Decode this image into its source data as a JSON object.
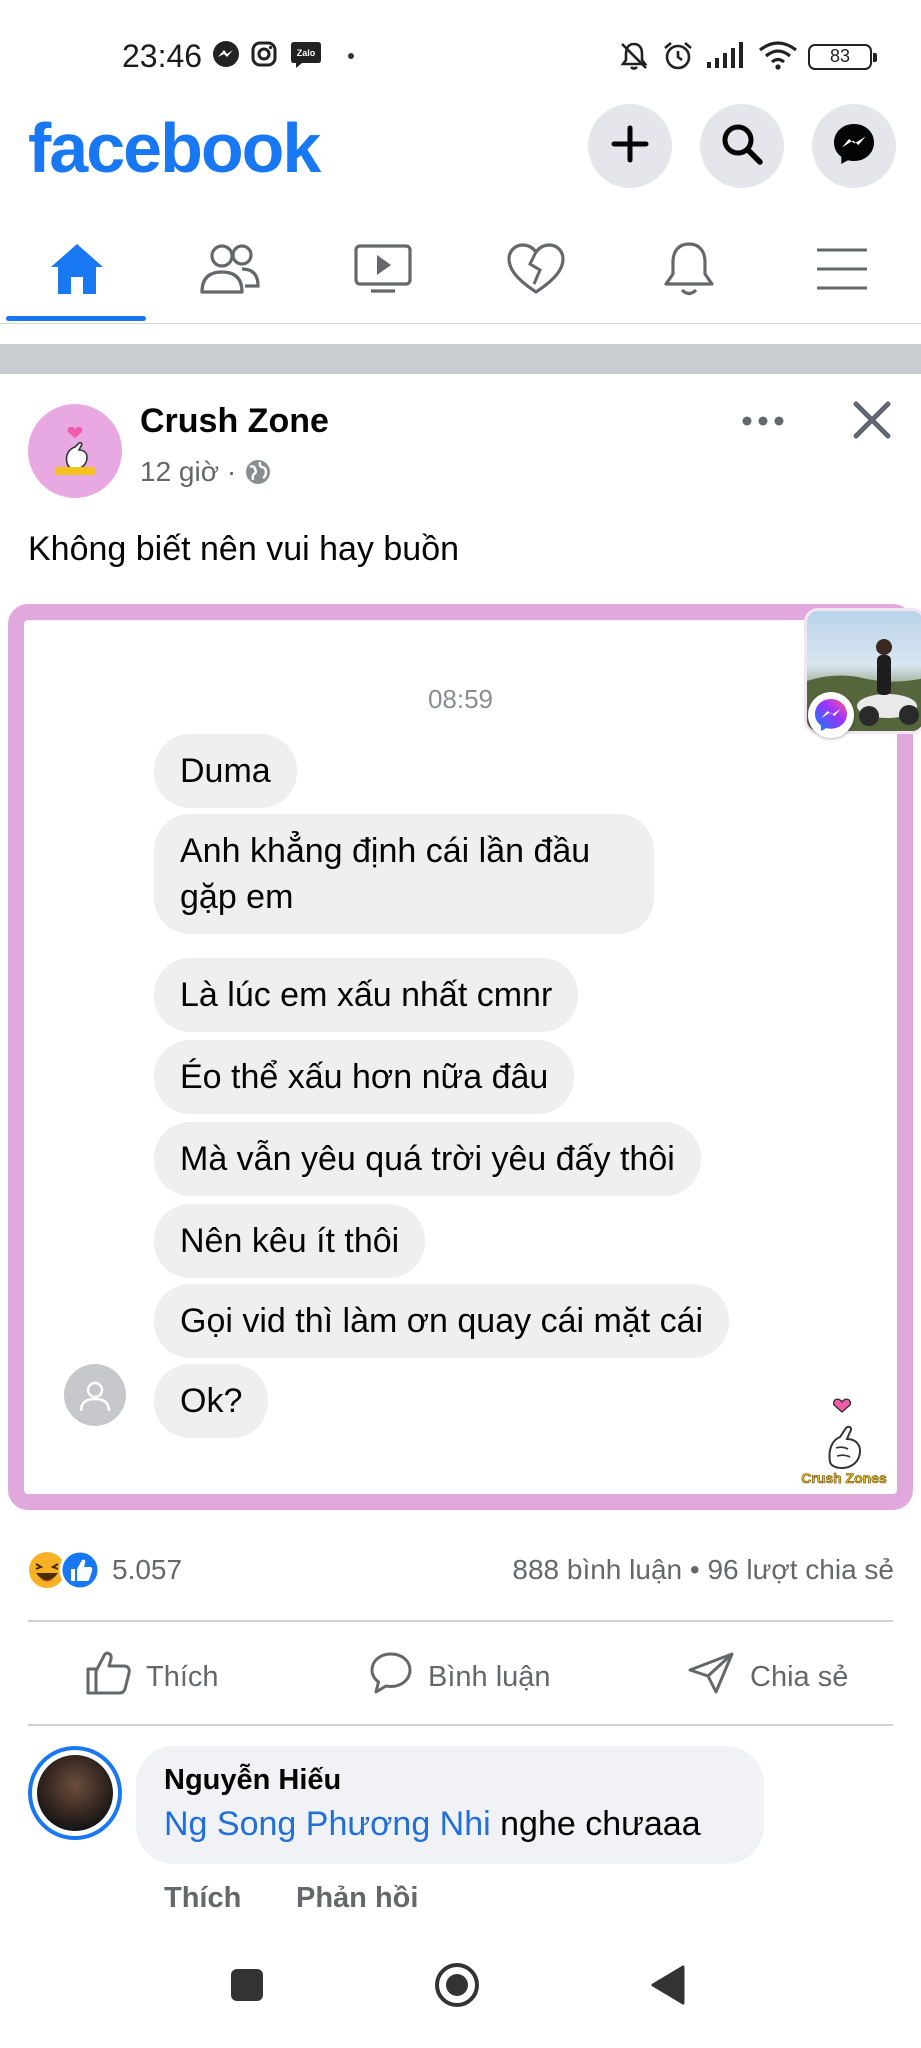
{
  "status_bar": {
    "time": "23:46",
    "notification_icons": [
      "messenger-icon",
      "instagram-icon",
      "zalo-icon",
      "dot-icon"
    ],
    "zalo_label": "Zalo",
    "system_icons": [
      "mute-icon",
      "alarm-icon",
      "signal-icon",
      "wifi-icon"
    ],
    "battery": "83"
  },
  "header": {
    "logo": "facebook",
    "brand_color": "#1877f2",
    "actions": [
      "add-icon",
      "search-icon",
      "messenger-icon"
    ]
  },
  "nav": {
    "tabs": [
      "home-icon",
      "friends-icon",
      "watch-icon",
      "dating-icon",
      "notifications-icon",
      "menu-icon"
    ],
    "active_tab": "home-icon"
  },
  "post": {
    "page_name": "Crush Zone",
    "time": "12 giờ · ",
    "privacy_icon": "globe-icon",
    "caption": "Không biết nên vui hay buồn",
    "image": {
      "chat_time": "08:59",
      "messages": [
        "Duma",
        "Anh khẳng định cái lần đầu gặp em",
        "Là lúc em xấu nhất cmnr",
        "Éo thể xấu hơn nữa đâu",
        "Mà vẫn yêu quá trời yêu đấy thôi",
        "Nên kêu ít thôi",
        "Gọi vid thì làm ơn quay cái mặt cái",
        "Ok?"
      ],
      "watermark": "Crush Zones",
      "frame_color": "#e0a8dc"
    },
    "reactions": {
      "icons": [
        "haha-icon",
        "like-icon"
      ],
      "count": "5.057"
    },
    "stats": "888 bình luận • 96 lượt chia sẻ",
    "actions": {
      "like": "Thích",
      "comment": "Bình luận",
      "share": "Chia sẻ"
    }
  },
  "comment": {
    "author": "Nguyễn Hiếu",
    "mention": "Ng Song Phương Nhi",
    "text": " nghe chưaaa",
    "like_label": "Thích",
    "reply_label": "Phản hồi"
  },
  "system_nav": [
    "recents-icon",
    "home-circle-icon",
    "back-icon"
  ]
}
